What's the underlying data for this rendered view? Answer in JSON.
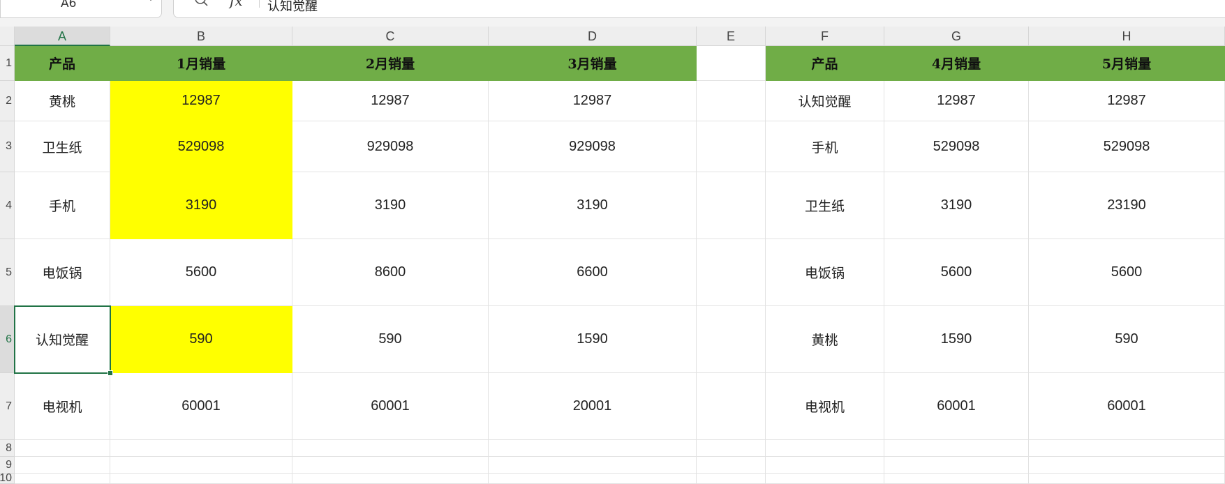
{
  "formula_bar": {
    "name_box": "A6",
    "fx_label": "fx",
    "content": "认知觉醒"
  },
  "columns": [
    "A",
    "B",
    "C",
    "D",
    "E",
    "F",
    "G",
    "H"
  ],
  "active_column": "A",
  "rows": [
    "1",
    "2",
    "3",
    "4",
    "5",
    "6",
    "7",
    "8",
    "9",
    "10"
  ],
  "active_row": "6",
  "colors": {
    "header_green": "#70ad47",
    "highlight_yellow": "#ffff00",
    "selection_green": "#217346"
  },
  "table1": {
    "headers": [
      "产品",
      "1月销量",
      "2月销量",
      "3月销量"
    ],
    "rows": [
      [
        "黄桃",
        "12987",
        "12987",
        "12987"
      ],
      [
        "卫生纸",
        "529098",
        "929098",
        "929098"
      ],
      [
        "手机",
        "3190",
        "3190",
        "3190"
      ],
      [
        "电饭锅",
        "5600",
        "8600",
        "6600"
      ],
      [
        "认知觉醒",
        "590",
        "590",
        "1590"
      ],
      [
        "电视机",
        "60001",
        "60001",
        "20001"
      ]
    ],
    "yellow_rows": [
      0,
      1,
      2,
      4
    ]
  },
  "table2": {
    "headers": [
      "产品",
      "4月销量",
      "5月销量"
    ],
    "rows": [
      [
        "认知觉醒",
        "12987",
        "12987"
      ],
      [
        "手机",
        "529098",
        "529098"
      ],
      [
        "卫生纸",
        "3190",
        "23190"
      ],
      [
        "电饭锅",
        "5600",
        "5600"
      ],
      [
        "黄桃",
        "1590",
        "590"
      ],
      [
        "电视机",
        "60001",
        "60001"
      ]
    ]
  }
}
